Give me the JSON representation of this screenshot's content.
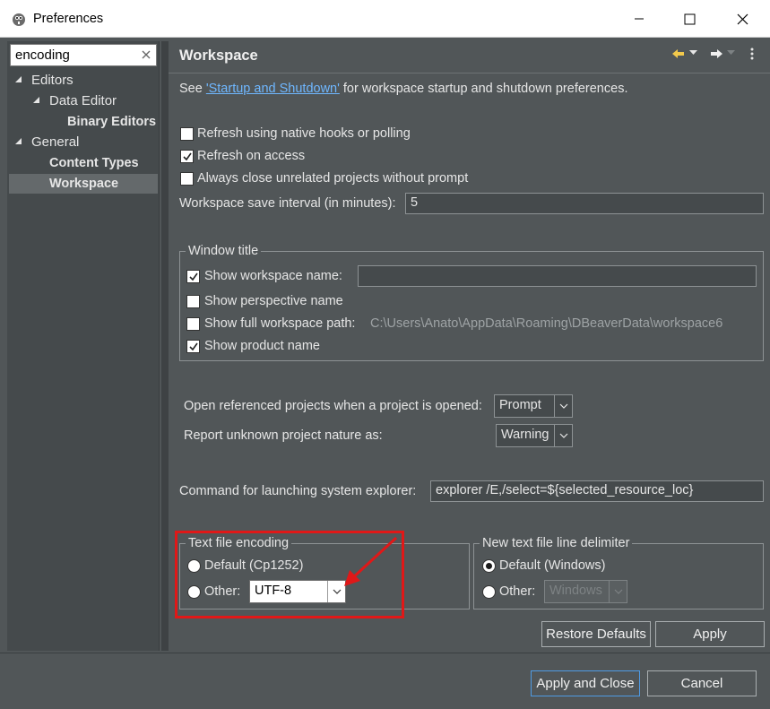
{
  "window": {
    "title": "Preferences",
    "icon": "dbeaver-beaver-icon"
  },
  "sidebar": {
    "filter_value": "encoding",
    "items": [
      {
        "label": "Editors",
        "level": 0,
        "expanded": true
      },
      {
        "label": "Data Editor",
        "level": 1,
        "expanded": true
      },
      {
        "label": "Binary Editors",
        "level": 2,
        "bold": true
      },
      {
        "label": "General",
        "level": 0,
        "expanded": true
      },
      {
        "label": "Content Types",
        "level": 1,
        "bold": true
      },
      {
        "label": "Workspace",
        "level": 1,
        "bold": true,
        "selected": true
      }
    ]
  },
  "page": {
    "title": "Workspace",
    "intro": {
      "prefix": "See ",
      "link": "'Startup and Shutdown'",
      "suffix": " for workspace startup and shutdown preferences."
    },
    "options": {
      "refresh_native": {
        "label": "Refresh using native hooks or polling",
        "checked": false
      },
      "refresh_access": {
        "label": "Refresh on access",
        "checked": true
      },
      "always_close": {
        "label": "Always close unrelated projects without prompt",
        "checked": false
      }
    },
    "save_interval": {
      "label": "Workspace save interval (in minutes):",
      "value": "5"
    },
    "window_title": {
      "legend": "Window title",
      "show_workspace_name": {
        "label": "Show workspace name:",
        "checked": true,
        "value": ""
      },
      "show_perspective_name": {
        "label": "Show perspective name",
        "checked": false
      },
      "show_full_path": {
        "label": "Show full workspace path:",
        "checked": false,
        "value": "C:\\Users\\Anato\\AppData\\Roaming\\DBeaverData\\workspace6"
      },
      "show_product_name": {
        "label": "Show product name",
        "checked": true
      }
    },
    "open_referenced": {
      "label": "Open referenced projects when a project is opened:",
      "value": "Prompt"
    },
    "report_unknown": {
      "label": "Report unknown project nature as:",
      "value": "Warning"
    },
    "system_explorer": {
      "label": "Command for launching system explorer:",
      "value": "explorer /E,/select=${selected_resource_loc}"
    },
    "text_encoding": {
      "legend": "Text file encoding",
      "default_label": "Default (Cp1252)",
      "other_label": "Other:",
      "other_value": "UTF-8",
      "selected": "other"
    },
    "line_delimiter": {
      "legend": "New text file line delimiter",
      "default_label": "Default (Windows)",
      "other_label": "Other:",
      "other_value": "Windows",
      "selected": "default"
    },
    "restore_defaults": "Restore Defaults",
    "apply": "Apply"
  },
  "footer": {
    "apply_close": "Apply and Close",
    "cancel": "Cancel"
  },
  "colors": {
    "background": "#515658",
    "highlight_box": "#e01818",
    "link": "#6fb7ff",
    "nav_back_arrow": "#f2c94c"
  }
}
